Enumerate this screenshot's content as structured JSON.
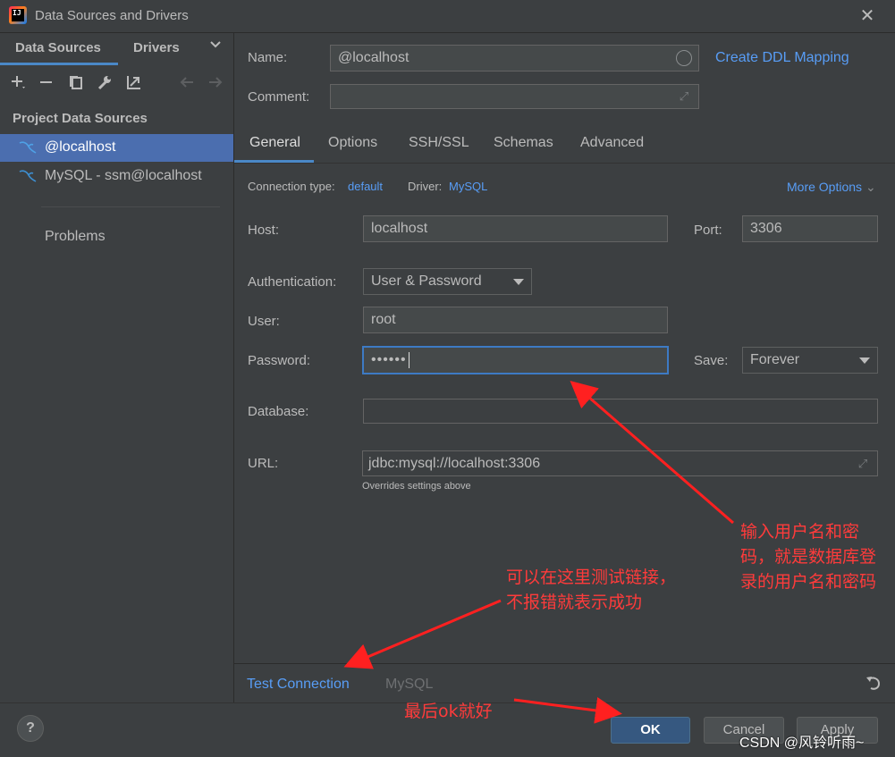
{
  "window": {
    "title": "Data Sources and Drivers"
  },
  "left_tabs": [
    {
      "label": "Data Sources"
    },
    {
      "label": "Drivers"
    }
  ],
  "toolbar_icons": [
    "add-icon",
    "remove-icon",
    "duplicate-icon",
    "wrench-icon",
    "jump-to-icon",
    "back-arrow-icon",
    "forward-arrow-icon"
  ],
  "project_heading": "Project Data Sources",
  "tree_items": [
    {
      "label": "@localhost",
      "selected": true
    },
    {
      "label": "MySQL - ssm@localhost",
      "selected": false
    }
  ],
  "problems_label": "Problems",
  "name_field": {
    "label": "Name:",
    "value": "@localhost"
  },
  "comment_field": {
    "label": "Comment:",
    "value": ""
  },
  "create_ddl_link": "Create DDL Mapping",
  "tabs": [
    {
      "label": "General",
      "active": true
    },
    {
      "label": "Options"
    },
    {
      "label": "SSH/SSL"
    },
    {
      "label": "Schemas"
    },
    {
      "label": "Advanced"
    }
  ],
  "connection": {
    "type_label": "Connection type:",
    "type_value": "default",
    "driver_label": "Driver:",
    "driver_value": "MySQL",
    "more_options": "More Options"
  },
  "host": {
    "label": "Host:",
    "value": "localhost"
  },
  "port": {
    "label": "Port:",
    "value": "3306"
  },
  "auth": {
    "label": "Authentication:",
    "value": "User & Password"
  },
  "user": {
    "label": "User:",
    "value": "root"
  },
  "password": {
    "label": "Password:",
    "value": "••••••"
  },
  "save": {
    "label": "Save:",
    "value": "Forever"
  },
  "database": {
    "label": "Database:",
    "value": ""
  },
  "url": {
    "label": "URL:",
    "value": "jdbc:mysql://localhost:3306",
    "hint": "Overrides settings above"
  },
  "bottom_strip": {
    "test_connection": "Test Connection",
    "driver_name": "MySQL"
  },
  "footer": {
    "help": "?",
    "ok": "OK",
    "cancel": "Cancel",
    "apply": "Apply"
  },
  "annotations": {
    "password_note": [
      "输入用户名和密",
      "码，就是数据库登",
      "录的用户名和密码"
    ],
    "test_note": [
      "可以在这里测试链接，",
      "不报错就表示成功"
    ],
    "ok_note": "最后ok就好"
  },
  "watermark": "CSDN @风铃听雨~",
  "colors": {
    "accent": "#4a88c7",
    "link": "#589df6",
    "selection": "#4b6eaf",
    "annotation": "#ff3b3b"
  }
}
